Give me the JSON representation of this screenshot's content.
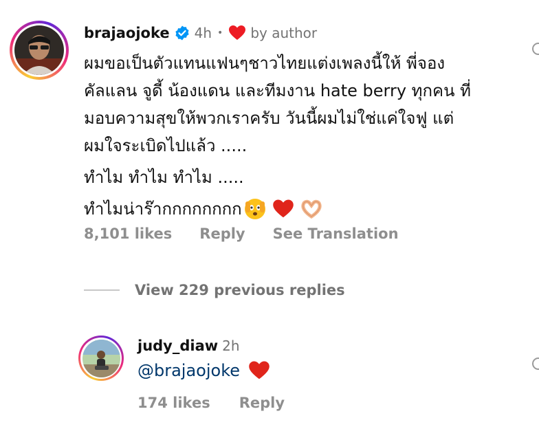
{
  "comment1": {
    "username": "brajaojoke",
    "time": "4h",
    "separator": "•",
    "by_author": "by author",
    "lines": [
      "ผมขอเป็นตัวแทนแฟนๆชาวไทยแต่งเพลงนี้ให้ พี่จอง",
      "คัลแลน จูดี้ น้องแดน และทีมงาน hate berry ทุกคน ที่",
      "มอบความสุขให้พวกเราครับ  วันนี้ผมไม่ใช่แค่ใจฟู แต่",
      "ผมใจระเบิดไปแล้ว ....."
    ],
    "line2": "ทำไม  ทำไม  ทำไม .....",
    "line3": "ทำไมน่าร๊ากกกกกกกก",
    "likes": "8,101 likes",
    "reply": "Reply",
    "see_translation": "See Translation"
  },
  "view_replies": {
    "label": "View 229 previous replies"
  },
  "comment2": {
    "username": "judy_diaw",
    "time": "2h",
    "mention": "@brajaojoke",
    "likes": "174 likes",
    "reply": "Reply"
  },
  "colors": {
    "text": "#111111",
    "muted": "#737373",
    "verified": "#0095f6",
    "heart": "#ed1c24",
    "mention": "#00376b"
  }
}
